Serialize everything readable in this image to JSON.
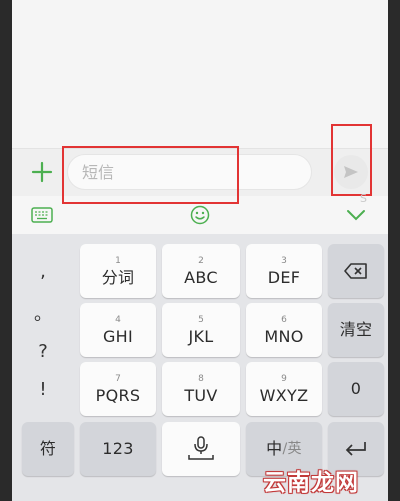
{
  "compose": {
    "input_placeholder": "短信",
    "plus_icon": "plus-icon",
    "send_icon": "send-arrow-icon"
  },
  "toolbar": {
    "left_icon": "keyboard-icon",
    "center_icon": "emoji-smile-icon",
    "right_icon": "chevron-down-icon",
    "accent_color": "#4caf50"
  },
  "keyboard": {
    "punctuation": [
      ",",
      "。",
      "?",
      "!"
    ],
    "rows": [
      [
        {
          "num": "1",
          "label": "分词"
        },
        {
          "num": "2",
          "label": "ABC"
        },
        {
          "num": "3",
          "label": "DEF"
        }
      ],
      [
        {
          "num": "4",
          "label": "GHI"
        },
        {
          "num": "5",
          "label": "JKL"
        },
        {
          "num": "6",
          "label": "MNO"
        }
      ],
      [
        {
          "num": "7",
          "label": "PQRS"
        },
        {
          "num": "8",
          "label": "TUV"
        },
        {
          "num": "9",
          "label": "WXYZ"
        }
      ]
    ],
    "right_column": {
      "backspace_icon": "backspace-icon",
      "clear": "清空",
      "zero": "0",
      "enter_icon": "enter-icon"
    },
    "bottom_row": {
      "symbol": "符",
      "numeric": "123",
      "space_icon": "microphone-icon",
      "lang_primary": "中",
      "lang_secondary": "/英"
    }
  },
  "watermark": "云南龙网"
}
